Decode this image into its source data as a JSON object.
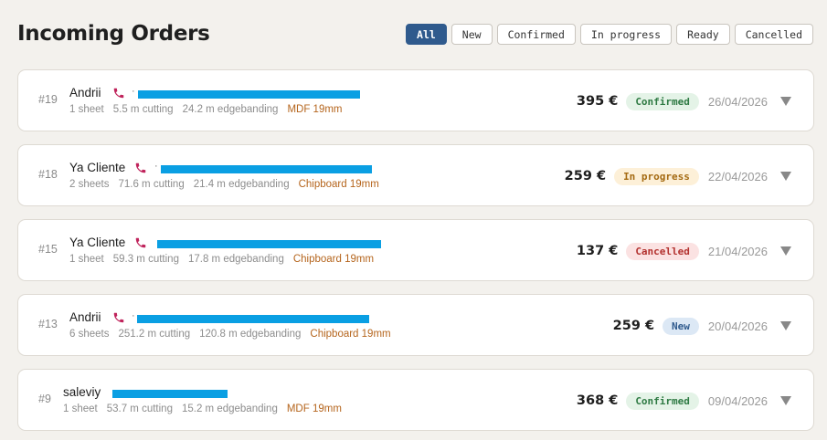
{
  "header": {
    "title": "Incoming Orders"
  },
  "filters": [
    "All",
    "New",
    "Confirmed",
    "In progress",
    "Ready",
    "Cancelled"
  ],
  "orders": [
    {
      "number": "#19",
      "customer": "Andrii",
      "separator": "·",
      "sheets": "1 sheet",
      "cutting": "5.5 m cutting",
      "edgebanding": "24.2 m edgebanding",
      "material": "MDF 19mm",
      "price": "395 €",
      "status": "Confirmed",
      "date": "26/04/2026"
    },
    {
      "number": "#18",
      "customer": "Ya Cliente",
      "separator": "·",
      "sheets": "2 sheets",
      "cutting": "71.6 m cutting",
      "edgebanding": "21.4 m edgebanding",
      "material": "Chipboard 19mm",
      "price": "259 €",
      "status": "In progress",
      "date": "22/04/2026"
    },
    {
      "number": "#15",
      "customer": "Ya Cliente",
      "separator": "",
      "sheets": "1 sheet",
      "cutting": "59.3 m cutting",
      "edgebanding": "17.8 m edgebanding",
      "material": "Chipboard 19mm",
      "price": "137 €",
      "status": "Cancelled",
      "date": "21/04/2026"
    },
    {
      "number": "#13",
      "customer": "Andrii",
      "separator": "·",
      "sheets": "6 sheets",
      "cutting": "251.2 m cutting",
      "edgebanding": "120.8 m edgebanding",
      "material": "Chipboard 19mm",
      "price": "259 €",
      "status": "New",
      "date": "20/04/2026"
    },
    {
      "number": "#9",
      "customer": "saleviy",
      "separator": "",
      "sheets": "1 sheet",
      "cutting": "53.7 m cutting",
      "edgebanding": "15.2 m edgebanding",
      "material": "MDF 19mm",
      "price": "368 €",
      "status": "Confirmed",
      "date": "09/04/2026"
    }
  ],
  "colors": {
    "accent": "#2f5a8d",
    "redaction": "#0a9fe3",
    "phone_icon": "#c0245c",
    "material": "#b5651d"
  },
  "icons": {
    "phone": "phone-icon",
    "expand": "chevron-down-icon"
  }
}
